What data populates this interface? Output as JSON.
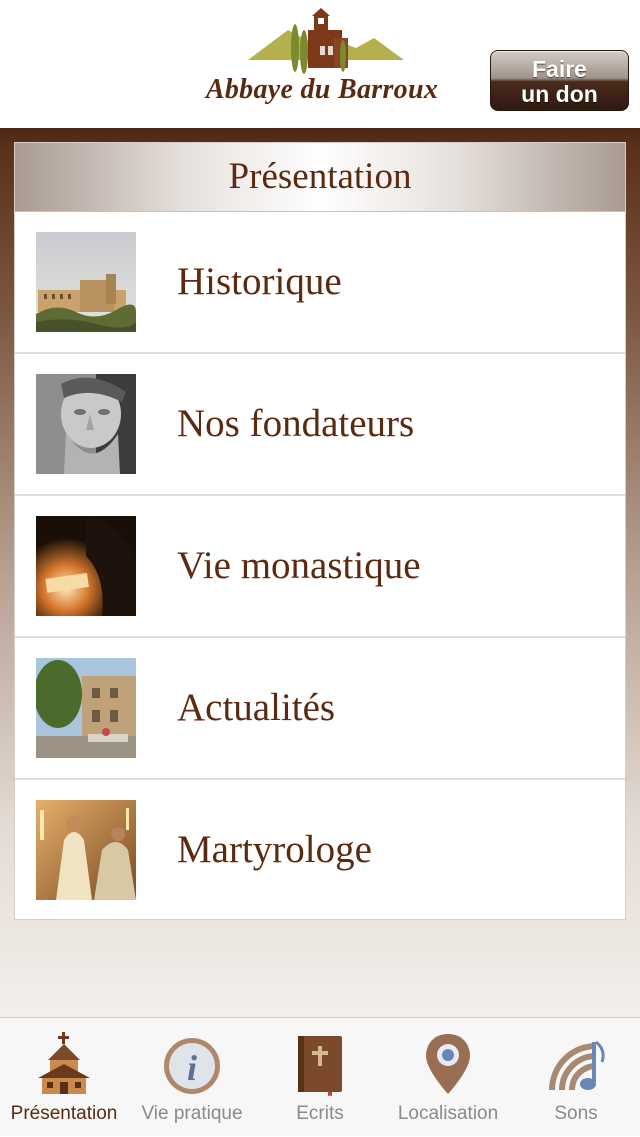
{
  "header": {
    "logo_text": "Abbaye du Barroux",
    "logo_icon": "abbey-logo",
    "donate_line1": "Faire",
    "donate_line2": "un don"
  },
  "panel": {
    "title": "Présentation",
    "items": [
      {
        "label": "Historique",
        "icon": "abbey-photo"
      },
      {
        "label": "Nos fondateurs",
        "icon": "founder-portrait"
      },
      {
        "label": "Vie monastique",
        "icon": "monk-reading-photo"
      },
      {
        "label": "Actualités",
        "icon": "village-photo"
      },
      {
        "label": "Martyrologe",
        "icon": "liturgy-photo"
      }
    ]
  },
  "tabbar": {
    "active": "Présentation",
    "tabs": [
      {
        "label": "Présentation",
        "icon": "church-icon"
      },
      {
        "label": "Vie pratique",
        "icon": "info-icon"
      },
      {
        "label": "Ecrits",
        "icon": "book-icon"
      },
      {
        "label": "Localisation",
        "icon": "location-pin-icon"
      },
      {
        "label": "Sons",
        "icon": "sound-icon"
      }
    ]
  },
  "colors": {
    "brand_brown": "#5b2a10",
    "background_top": "#4e2713",
    "background_bottom": "#f3efec"
  }
}
